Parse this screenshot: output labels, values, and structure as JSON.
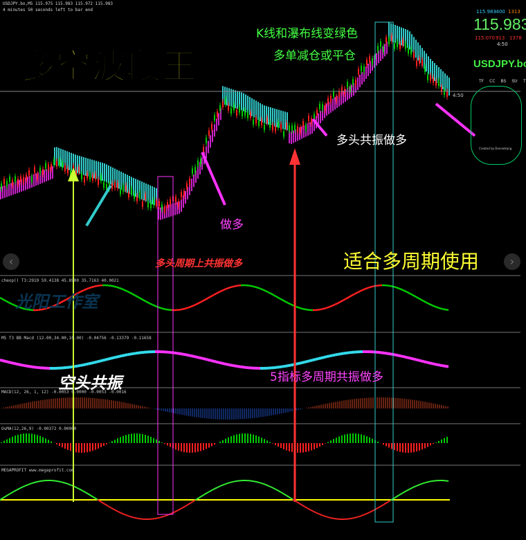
{
  "header": {
    "symbol_line": "USDJPY.bo,M5  115.975 115.983 115.972 115.983",
    "bar_timer": "4 minutes 50 seconds left to bar end"
  },
  "price_panel": {
    "bid_small": "115.983",
    "change_small": "-400",
    "spread_small": "1313",
    "big_price": "115.983",
    "high": "115.070",
    "range1": "913",
    "range2": "1378",
    "timer": "4:50",
    "pair": "USDJPY.bo",
    "tabs": [
      "TF",
      "CC",
      "BS",
      "Str",
      "TR"
    ],
    "right_tag": "4:50",
    "credit": "Created by Dennelkang"
  },
  "annotations": {
    "main_title": "多空波段王",
    "kline_note_line1": "K线和瀑布线变绿色",
    "kline_note_line2": "多单减仓或平仓",
    "bull_resonance": "多头共振做多",
    "go_long": "做多",
    "multi_period": "多头周期上共振做多",
    "suitable": "适合多周期使用",
    "short_resonance": "空头共振",
    "five_indicator": "5指标多周期共振做多",
    "watermark": "光阳工作室"
  },
  "indicators": {
    "ind1": "cheop() T3:2919 59.4138 45.8900 35.7163 40.0021",
    "ind2": "M5  T3 BB Macd (12.00,34.00,10.00) -0.04756 -0.13379 -0.11658",
    "ind3": "MACD(12, 26, 1, 12) -0.0053 0.0000 -0.0053 -0.0016",
    "ind4": "OsMA(12,26,9) -0.00372 0.00000",
    "ind5": "MEGAPROFIT  www.megaprofit.com"
  },
  "colors": {
    "bull_candle": "#00cc00",
    "bear_candle": "#ff2020",
    "bear_fill": "#cc22cc",
    "bull_fill": "#33cccc",
    "title_yellow": "#ffff33",
    "arrow_red": "#ff3333",
    "arrow_green": "#ccff33",
    "arrow_magenta": "#ff33ff",
    "zero_line": "#ffff00"
  }
}
